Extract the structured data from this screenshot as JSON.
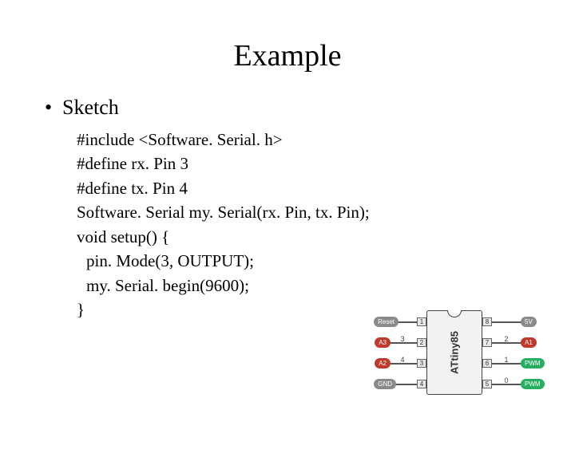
{
  "title": "Example",
  "bullet": {
    "dot": "•",
    "label": "Sketch"
  },
  "code": {
    "l1": "#include <Software. Serial. h>",
    "l2": "#define rx. Pin 3",
    "l3": "#define tx. Pin 4",
    "l4": "Software. Serial my. Serial(rx. Pin, tx. Pin);",
    "l5": "void setup() {",
    "l6": "pin. Mode(3, OUTPUT);",
    "l7": "my. Serial. begin(9600);",
    "l8": "}"
  },
  "chip": {
    "name": "ATtiny85",
    "left": {
      "nums": [
        "1",
        "2",
        "3",
        "4"
      ],
      "tags": [
        {
          "label": "Reset",
          "color": "grey"
        },
        {
          "label": "A3",
          "color": "red"
        },
        {
          "label": "A2",
          "color": "red"
        },
        {
          "label": "GND",
          "color": "grey"
        }
      ],
      "nums2": [
        "3",
        "4"
      ]
    },
    "right": {
      "nums": [
        "8",
        "7",
        "6",
        "5"
      ],
      "tags": [
        {
          "label": "5V",
          "color": "grey"
        },
        {
          "label": "A1",
          "color": "red"
        },
        {
          "label": "PWM",
          "color": "green"
        },
        {
          "label": "PWM",
          "color": "green"
        }
      ],
      "nums2": [
        "2",
        "1",
        "0"
      ]
    }
  }
}
